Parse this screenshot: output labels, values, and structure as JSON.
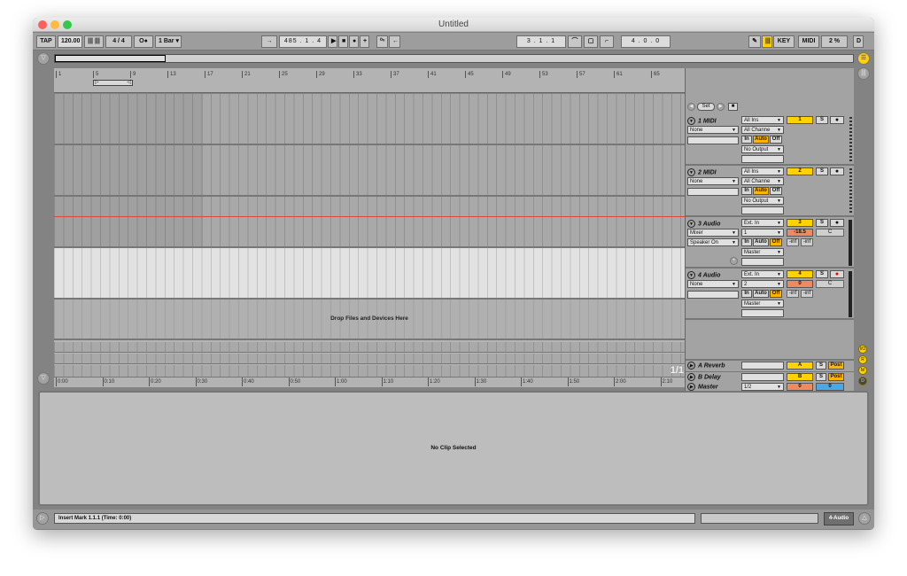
{
  "window": {
    "title": "Untitled"
  },
  "control_bar": {
    "tap": "TAP",
    "tempo": "120.00",
    "nudge": "|||  |||",
    "signature": "4 / 4",
    "metro": "O●",
    "quantize": "1 Bar",
    "follow": "→",
    "position": "485 . 1 . 4",
    "play": "▶",
    "stop": "■",
    "record": "●",
    "overdub": "+",
    "automation": "⁰ⁿ",
    "back_arrow": "←",
    "loop_start": "3 . 1 . 1",
    "punch_in": "⌒",
    "loop_toggle": "▢",
    "punch_out": "⌐",
    "loop_length": "4 . 0 . 0",
    "draw": "✎",
    "key_map_icon": "|||",
    "key": "KEY",
    "midi": "MIDI",
    "cpu": "2 %",
    "disk": "D"
  },
  "ruler": {
    "bars": [
      "1",
      "5",
      "9",
      "13",
      "17",
      "21",
      "25",
      "29",
      "33",
      "37",
      "41",
      "45",
      "49",
      "53",
      "57",
      "61",
      "65"
    ]
  },
  "time_ruler": {
    "ticks": [
      "0:00",
      "0:10",
      "0:20",
      "0:30",
      "0:40",
      "0:50",
      "1:00",
      "1:10",
      "1:20",
      "1:30",
      "1:40",
      "1:50",
      "2:00",
      "2:10"
    ]
  },
  "scene": {
    "set_label": "Set"
  },
  "tracks": [
    {
      "name": "1 MIDI",
      "input_type": "All Ins",
      "input_channel": "All Channe",
      "monitor": [
        "In",
        "Auto",
        "Off"
      ],
      "output": "No Output",
      "device": "None",
      "number": "1",
      "solo": "S",
      "arm": "●"
    },
    {
      "name": "2 MIDI",
      "input_type": "All Ins",
      "input_channel": "All Channe",
      "monitor": [
        "In",
        "Auto",
        "Off"
      ],
      "output": "No Output",
      "device": "None",
      "number": "2",
      "solo": "S",
      "arm": "●"
    },
    {
      "name": "3 Audio",
      "input_type": "Ext. In",
      "input_channel": "1",
      "monitor": [
        "In",
        "Auto",
        "Off"
      ],
      "output": "Master",
      "device": "Mixer",
      "device2": "Speaker On",
      "number": "3",
      "solo": "S",
      "arm": "●",
      "volume": "-18.5",
      "pan": "C",
      "peak_l": "-inf",
      "peak_r": "-inf"
    },
    {
      "name": "4 Audio",
      "input_type": "Ext. In",
      "input_channel": "2",
      "monitor": [
        "In",
        "Auto",
        "Off"
      ],
      "output": "Master",
      "device": "None",
      "number": "4",
      "solo": "S",
      "arm": "●",
      "volume": "0",
      "pan": "C",
      "peak_l": "-inf",
      "peak_r": "-inf"
    }
  ],
  "drop_text": "Drop Files and Devices Here",
  "returns": [
    {
      "name": "A Reverb",
      "letter": "A",
      "solo": "S",
      "post": "Post"
    },
    {
      "name": "B Delay",
      "letter": "B",
      "solo": "S",
      "post": "Post"
    }
  ],
  "master": {
    "name": "Master",
    "output": "1/2",
    "volume": "0",
    "pan": "0",
    "fraction": "1/1"
  },
  "detail_view": {
    "text": "No Clip Selected"
  },
  "status_bar": {
    "text": "Insert Mark 1.1.1 (Time: 0:00)",
    "selected_track": "4-Audio"
  },
  "side_buttons": [
    "I/O",
    "R",
    "M",
    "D"
  ]
}
